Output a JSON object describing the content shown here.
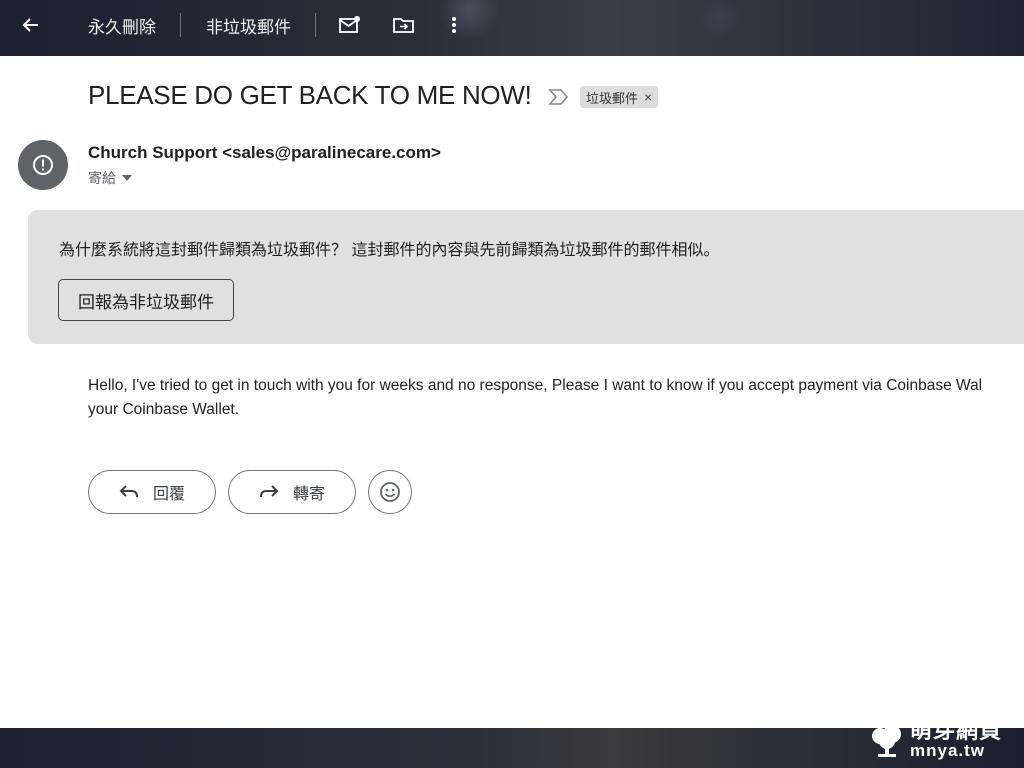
{
  "toolbar": {
    "back_icon": "arrow-left-icon",
    "delete_forever_label": "永久刪除",
    "not_spam_label": "非垃圾郵件",
    "mark_unread_icon": "mail-dot-icon",
    "move_to_icon": "folder-move-icon",
    "more_icon": "more-vert-icon"
  },
  "email": {
    "subject": "PLEASE DO GET BACK TO ME NOW!",
    "label": "垃圾郵件",
    "label_remove": "×",
    "sender": "Church Support <sales@paralinecare.com>",
    "to_me": "寄給"
  },
  "spam_warning": {
    "message": "為什麼系統將這封郵件歸類為垃圾郵件？ 這封郵件的內容與先前歸類為垃圾郵件的郵件相似。",
    "report_button": "回報為非垃圾郵件"
  },
  "body": {
    "line1": "Hello, I've tried to get in touch with you for weeks and no response, Please I want to know if you accept payment via Coinbase Wal",
    "line2": "your Coinbase Wallet."
  },
  "actions": {
    "reply": "回覆",
    "forward": "轉寄",
    "emoji_icon": "smiley-icon"
  },
  "watermark": {
    "cn": "萌芽網頁",
    "url": "mnya.tw"
  },
  "colors": {
    "panel_bg": "#ffffff",
    "spam_box_bg": "#e0e0e0",
    "avatar_bg": "#5f6368"
  }
}
